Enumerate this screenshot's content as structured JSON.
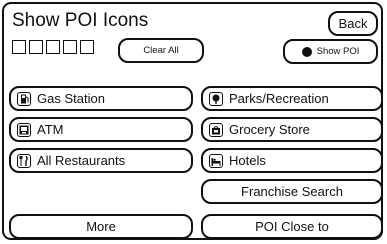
{
  "header": {
    "title": "Show POI Icons",
    "back_label": "Back"
  },
  "toolbar": {
    "clear_all_label": "Clear All",
    "show_poi_label": "Show POI",
    "icon_slot_count": 5
  },
  "poi_categories": {
    "left": [
      {
        "label": "Gas Station",
        "icon": "gas-pump-icon"
      },
      {
        "label": "ATM",
        "icon": "atm-icon"
      },
      {
        "label": "All Restaurants",
        "icon": "fork-knife-icon"
      }
    ],
    "right": [
      {
        "label": "Parks/Recreation",
        "icon": "tree-icon"
      },
      {
        "label": "Grocery Store",
        "icon": "grocery-bag-icon"
      },
      {
        "label": "Hotels",
        "icon": "bed-icon"
      }
    ]
  },
  "actions": {
    "franchise_search_label": "Franchise Search",
    "more_label": "More",
    "poi_close_to_label": "POI Close to"
  }
}
